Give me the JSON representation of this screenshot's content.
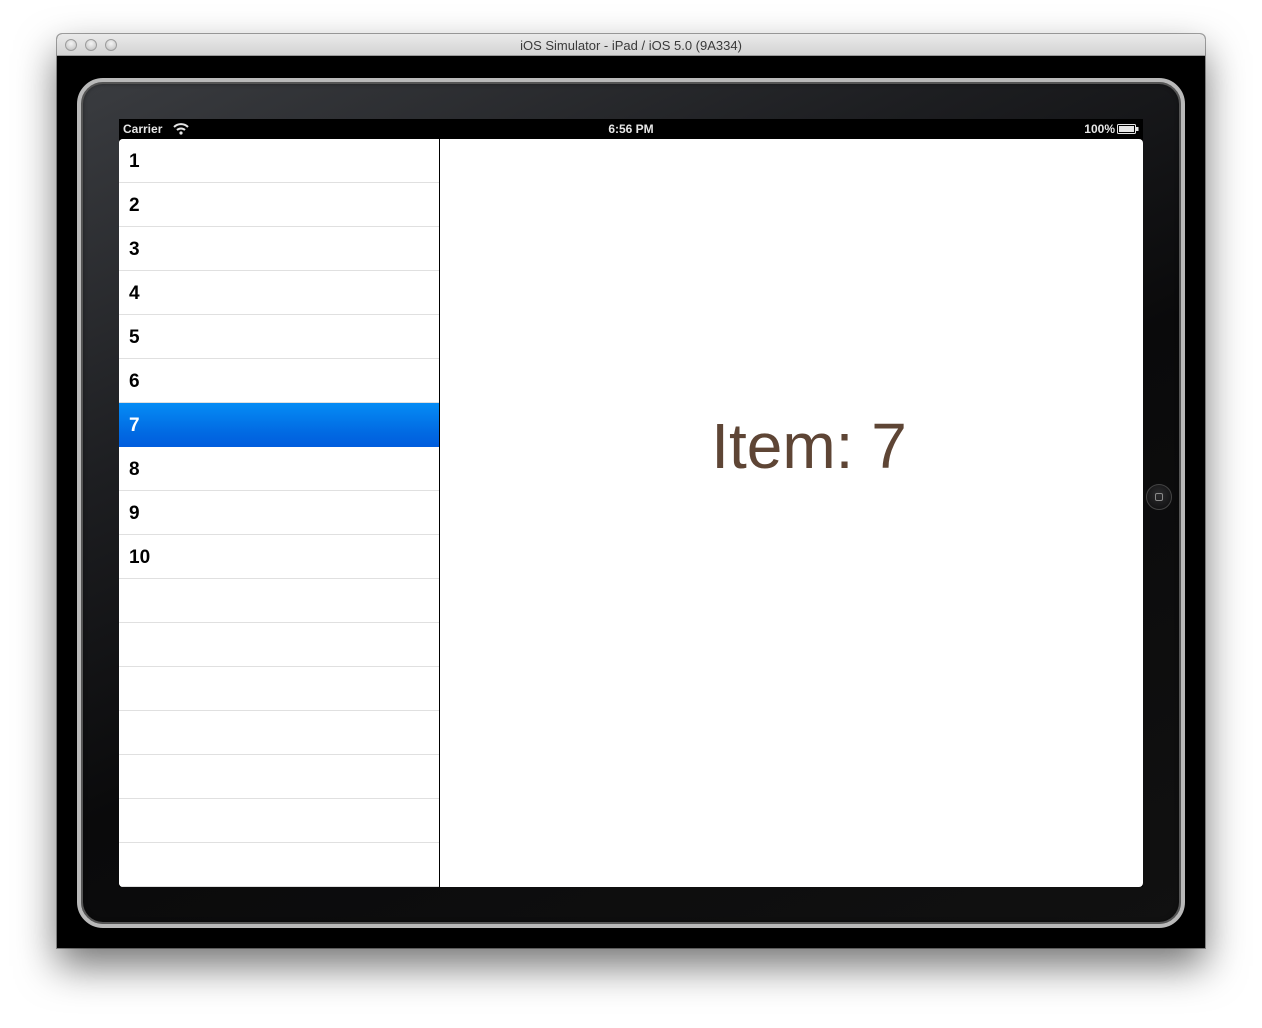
{
  "window": {
    "title": "iOS Simulator - iPad / iOS 5.0 (9A334)"
  },
  "statusbar": {
    "carrier": "Carrier",
    "time": "6:56 PM",
    "battery": "100%"
  },
  "master": {
    "items": [
      {
        "label": "1"
      },
      {
        "label": "2"
      },
      {
        "label": "3"
      },
      {
        "label": "4"
      },
      {
        "label": "5"
      },
      {
        "label": "6"
      },
      {
        "label": "7"
      },
      {
        "label": "8"
      },
      {
        "label": "9"
      },
      {
        "label": "10"
      },
      {
        "label": ""
      },
      {
        "label": ""
      },
      {
        "label": ""
      },
      {
        "label": ""
      },
      {
        "label": ""
      },
      {
        "label": ""
      },
      {
        "label": ""
      }
    ],
    "selected_label": "7"
  },
  "detail": {
    "text": "Item: 7"
  },
  "colors": {
    "selection": "#0169e2",
    "detail_text": "#5e4535"
  }
}
